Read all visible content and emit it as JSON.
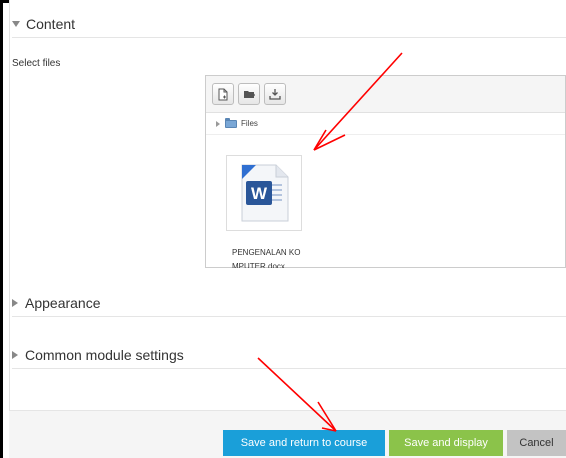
{
  "sections": {
    "content": {
      "title": "Content",
      "expanded": true
    },
    "appearance": {
      "title": "Appearance",
      "expanded": false
    },
    "common": {
      "title": "Common module settings",
      "expanded": false
    }
  },
  "form": {
    "select_files_label": "Select files"
  },
  "filemanager": {
    "toolbar": [
      "add-file-icon",
      "create-folder-icon",
      "download-icon"
    ],
    "path": "Files",
    "file": {
      "name": "PENGENALAN KOMPUTER.docx",
      "icon": "word-document-icon",
      "icon_color": "#2a5699"
    }
  },
  "buttons": {
    "save_return": "Save and return to course",
    "save_display": "Save and display",
    "cancel": "Cancel"
  },
  "colors": {
    "primary": "#1a9fd9",
    "success": "#8bc34a",
    "cancel": "#c3c3c3",
    "annotation": "#ff0000"
  }
}
